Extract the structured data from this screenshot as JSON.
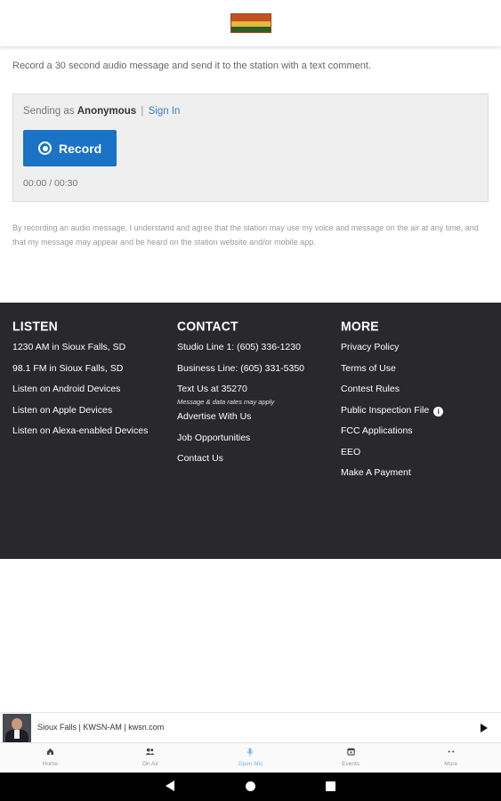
{
  "intro_text": "Record a 30 second audio message and send it to the station with a text comment.",
  "recorder": {
    "sending_prefix": "Sending as",
    "sending_user": "Anonymous",
    "separator": "|",
    "sign_in": "Sign In",
    "record_label": "Record",
    "timer": "00:00 / 00:30"
  },
  "disclaimer": "By recording an audio message, I understand and agree that the station may use my voice and message on the air at any time, and that my message may appear and be heard on the station website and/or mobile app.",
  "footer": {
    "listen": {
      "heading": "LISTEN",
      "items": [
        "1230 AM in Sioux Falls, SD",
        "98.1 FM in Sioux Falls, SD",
        "Listen on Android Devices",
        "Listen on Apple Devices",
        "Listen on Alexa-enabled Devices"
      ]
    },
    "contact": {
      "heading": "CONTACT",
      "studio": "Studio Line 1: (605) 336-1230",
      "business": "Business Line: (605) 331-5350",
      "text_us": "Text Us at 35270",
      "text_note": "Message & data rates may apply",
      "advertise": "Advertise With Us",
      "jobs": "Job Opportunities",
      "contact_us": "Contact Us"
    },
    "more": {
      "heading": "MORE",
      "privacy": "Privacy Policy",
      "terms": "Terms of Use",
      "contest": "Contest Rules",
      "public_file": "Public Inspection File",
      "fcc": "FCC Applications",
      "eeo": "EEO",
      "payment": "Make A Payment"
    }
  },
  "player": {
    "title": "Sioux Falls | KWSN-AM | kwsn.com"
  },
  "tabs": [
    {
      "label": "Home",
      "icon": "home-icon"
    },
    {
      "label": "On Air",
      "icon": "people-icon"
    },
    {
      "label": "Open Mic",
      "icon": "microphone-icon",
      "active": true
    },
    {
      "label": "Events",
      "icon": "calendar-icon"
    },
    {
      "label": "More",
      "icon": "more-dots-icon"
    }
  ],
  "colors": {
    "accent": "#1a73c4",
    "footer_bg": "#28282d",
    "active_tab": "#7ab7e8"
  }
}
